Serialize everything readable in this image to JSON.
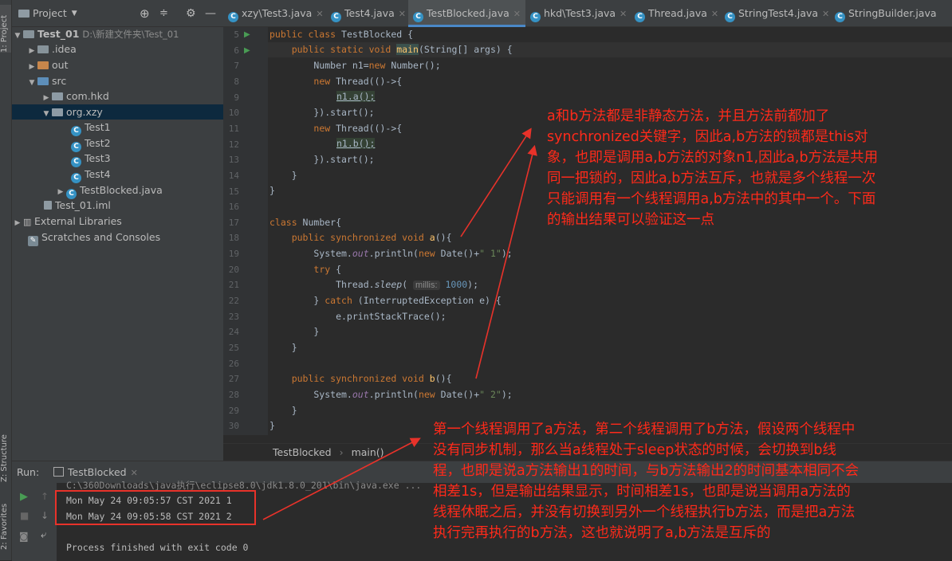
{
  "left_strip": {
    "project_label": "1: Project",
    "structure_label": "Z: Structure",
    "favorites_label": "2: Favorites"
  },
  "project_panel": {
    "title": "Project",
    "tree": [
      {
        "label": "Test_01",
        "path": "D:\\新建文件夹\\Test_01"
      },
      {
        "label": ".idea"
      },
      {
        "label": "out"
      },
      {
        "label": "src"
      },
      {
        "label": "com.hkd"
      },
      {
        "label": "org.xzy"
      },
      {
        "label": "Test1"
      },
      {
        "label": "Test2"
      },
      {
        "label": "Test3"
      },
      {
        "label": "Test4"
      },
      {
        "label": "TestBlocked.java"
      },
      {
        "label": "Test_01.iml"
      },
      {
        "label": "External Libraries"
      },
      {
        "label": "Scratches and Consoles"
      }
    ]
  },
  "tabs": [
    {
      "label": "xzy\\Test3.java"
    },
    {
      "label": "Test4.java"
    },
    {
      "label": "TestBlocked.java"
    },
    {
      "label": "hkd\\Test3.java"
    },
    {
      "label": "Thread.java"
    },
    {
      "label": "StringTest4.java"
    },
    {
      "label": "StringBuilder.java"
    }
  ],
  "editor": {
    "line_numbers": [
      "5",
      "6",
      "7",
      "8",
      "9",
      "10",
      "11",
      "12",
      "13",
      "14",
      "15",
      "16",
      "17",
      "18",
      "19",
      "20",
      "21",
      "22",
      "23",
      "24",
      "25",
      "26",
      "27",
      "28",
      "29",
      "30"
    ],
    "code": {
      "l5a": "public class ",
      "l5b": "TestBlocked {",
      "l6a": "    public static void ",
      "l6b": "main",
      "l6c": "(String[] args) {",
      "l7a": "        Number n1=",
      "l7b": "new ",
      "l7c": "Number();",
      "l8a": "        ",
      "l8b": "new ",
      "l8c": "Thread(()->{",
      "l9": "n1.a();",
      "l10": "        }).start();",
      "l11a": "        ",
      "l11b": "new ",
      "l11c": "Thread(()->{",
      "l12": "n1.b();",
      "l13": "        }).start();",
      "l14": "    }",
      "l15": "}",
      "l17a": "class ",
      "l17b": "Number{",
      "l18a": "    public synchronized void ",
      "l18b": "a",
      "l18c": "(){",
      "l19a": "        System.",
      "l19b": "out",
      "l19c": ".println(",
      "l19d": "new ",
      "l19e": "Date()+",
      "l19f": "\" 1\"",
      "l19g": ");",
      "l20a": "        ",
      "l20b": "try ",
      "l20c": "{",
      "l21a": "            Thread.",
      "l21b": "sleep",
      "l21c": "( ",
      "l21hint": "millis:",
      "l21d": " 1000",
      "l21e": ");",
      "l22a": "        } ",
      "l22b": "catch ",
      "l22c": "(InterruptedException e) {",
      "l23": "            e.printStackTrace();",
      "l24": "        }",
      "l25": "    }",
      "l27a": "    public synchronized void ",
      "l27b": "b",
      "l27c": "(){",
      "l28a": "        System.",
      "l28b": "out",
      "l28c": ".println(",
      "l28d": "new ",
      "l28e": "Date()+",
      "l28f": "\" 2\"",
      "l28g": ");",
      "l29": "    }",
      "l30": "}"
    }
  },
  "breadcrumb": {
    "class": "TestBlocked",
    "method": "main()"
  },
  "run_panel": {
    "run_label": "Run:",
    "tab_label": "TestBlocked",
    "command": "C:\\360Downloads\\java执行\\eclipse8.0\\jdk1.8.0_201\\bin\\java.exe ...",
    "output": [
      "Mon May 24 09:05:57 CST 2021 1",
      "Mon May 24 09:05:58 CST 2021 2"
    ],
    "exit": "Process finished with exit code 0"
  },
  "annotations": {
    "top": [
      "a和b方法都是非静态方法，并且方法前都加了",
      "synchronized关键字，因此a,b方法的锁都是this对",
      "象，也即是调用a,b方法的对象n1,因此a,b方法是共用",
      "同一把锁的，因此a,b方法互斥，也就是多个线程一次",
      "只能调用有一个线程调用a,b方法中的其中一个。下面",
      "的输出结果可以验证这一点"
    ],
    "bottom": [
      "第一个线程调用了a方法，第二个线程调用了b方法，假设两个线程中",
      "没有同步机制，那么当a线程处于sleep状态的时候，会切换到b线",
      "程，也即是说a方法输出1的时间，与b方法输出2的时间基本相同不会",
      "相差1s，但是输出结果显示，时间相差1s，也即是说当调用a方法的",
      "线程休眠之后，并没有切换到另外一个线程执行b方法，而是把a方法",
      "执行完再执行的b方法，这也就说明了a,b方法是互斥的"
    ]
  },
  "colors": {
    "accent": "#4a88c7",
    "annotation": "#ff2a1a",
    "selection": "#0d293e"
  }
}
